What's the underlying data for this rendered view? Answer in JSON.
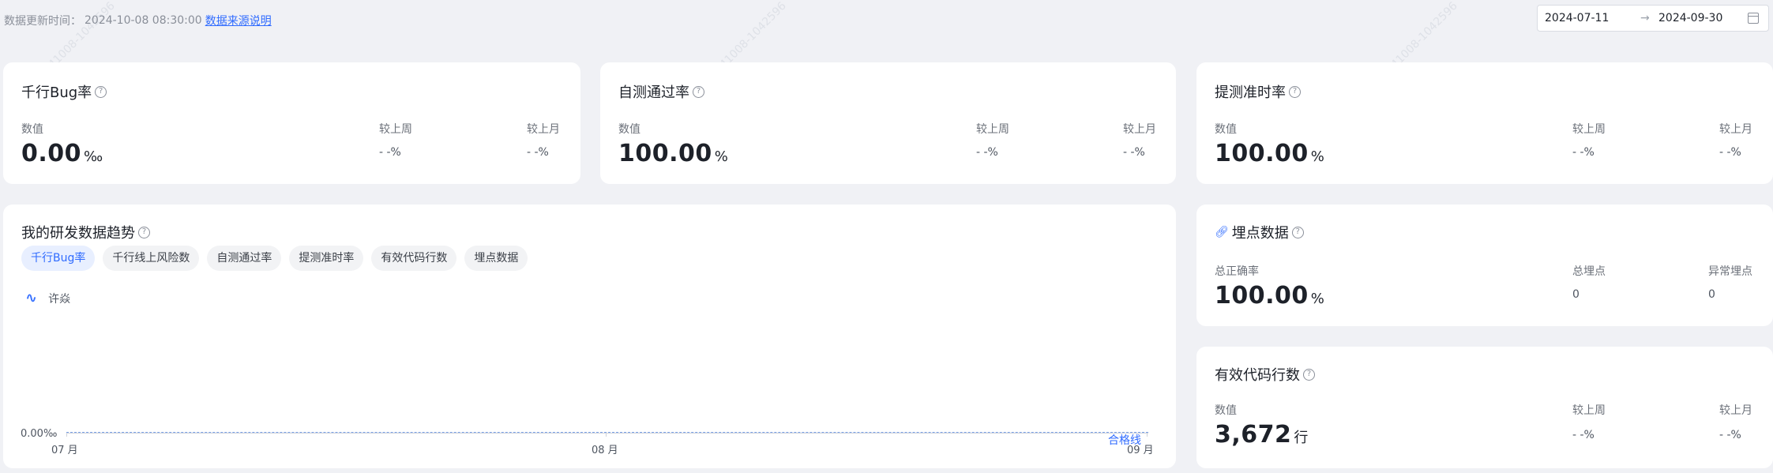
{
  "header": {
    "update_label": "数据更新时间：",
    "update_time": "2024-10-08 08:30:00",
    "source_link": "数据来源说明"
  },
  "date_range": {
    "start": "2024-07-11",
    "separator": "→",
    "end": "2024-09-30"
  },
  "metrics": [
    {
      "title": "千行Bug率",
      "value_label": "数值",
      "value": "0.00",
      "unit": "‰",
      "wow_label": "较上周",
      "wow": "- -%",
      "mom_label": "较上月",
      "mom": "- -%"
    },
    {
      "title": "自测通过率",
      "value_label": "数值",
      "value": "100.00",
      "unit": "%",
      "wow_label": "较上周",
      "wow": "- -%",
      "mom_label": "较上月",
      "mom": "- -%"
    },
    {
      "title": "提测准时率",
      "value_label": "数值",
      "value": "100.00",
      "unit": "%",
      "wow_label": "较上周",
      "wow": "- -%",
      "mom_label": "较上月",
      "mom": "- -%"
    }
  ],
  "trend": {
    "title": "我的研发数据趋势",
    "tabs": [
      "千行Bug率",
      "千行线上风险数",
      "自测通过率",
      "提测准时率",
      "有效代码行数",
      "埋点数据"
    ],
    "active_tab": 0,
    "legend": "许焱",
    "y_label": "0.00‰",
    "x_ticks": [
      "07 月",
      "08 月",
      "09 月"
    ],
    "qualified_label": "合格线"
  },
  "tracking": {
    "title": "埋点数据",
    "accuracy_label": "总正确率",
    "accuracy": "100.00",
    "accuracy_unit": "%",
    "total_label": "总埋点",
    "total": "0",
    "abnormal_label": "异常埋点",
    "abnormal": "0"
  },
  "code_lines": {
    "title": "有效代码行数",
    "value_label": "数值",
    "value": "3,672",
    "unit": "行",
    "wow_label": "较上周",
    "wow": "- -%",
    "mom_label": "较上月",
    "mom": "- -%"
  },
  "chart_data": {
    "type": "line",
    "x": [
      "07 月",
      "08 月",
      "09 月"
    ],
    "series": [
      {
        "name": "许焱",
        "values": [
          0,
          0,
          0
        ]
      }
    ],
    "yticks": [
      "0.00‰"
    ],
    "annotations": [
      "合格线"
    ]
  },
  "watermark": "241008-1042596",
  "colors": {
    "accent": "#2f6bff",
    "background": "#f0f1f5",
    "card": "#ffffff"
  }
}
